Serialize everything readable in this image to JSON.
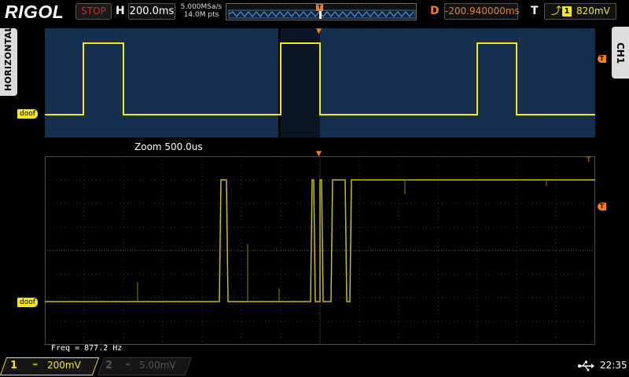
{
  "header": {
    "brand": "RIGOL",
    "run_status": "STOP",
    "horizontal_label": "H",
    "timebase": "200.0ms",
    "sample_rate": "5.000MSa/s",
    "memory_depth": "14.0M pts",
    "trigger_marker": "T",
    "delay_label": "D",
    "delay_value": "-200.940000ms",
    "trigger_label": "T",
    "trigger_edge": "⸙",
    "trigger_channel": "1",
    "trigger_level": "820mV"
  },
  "side_tabs": {
    "left": "HORIZONTAL",
    "right": "CH1"
  },
  "overview": {
    "ref_tag": "doof",
    "trigger_marker": "T"
  },
  "zoom": {
    "label": "Zoom  500.0us",
    "ref_tag": "doof",
    "trigger_marker": "T"
  },
  "measurement": {
    "freq": "Freq = 877.2 Hz"
  },
  "footer": {
    "ch1": {
      "number": "1",
      "coupling": "═",
      "scale": "200mV"
    },
    "ch2": {
      "number": "2",
      "coupling": "═",
      "scale": "5.00mV"
    },
    "usb_icon": "usb-icon",
    "clock": "22:35"
  },
  "colors": {
    "trace": "#f5e51a",
    "trigger": "#f08020",
    "overview_bg": "#14304e",
    "stop": "#e2261b"
  }
}
